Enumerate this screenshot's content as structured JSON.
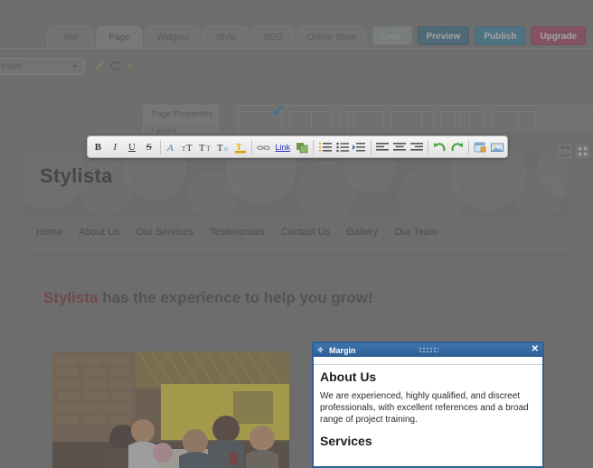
{
  "header": {
    "tabs": [
      {
        "label": "Site",
        "active": false
      },
      {
        "label": "Page",
        "active": true
      },
      {
        "label": "Widgets",
        "active": false
      },
      {
        "label": "Style",
        "active": false
      },
      {
        "label": "SEO",
        "active": false
      },
      {
        "label": "Online Store",
        "active": false
      }
    ],
    "actions": [
      {
        "label": "Save",
        "style": "act-save"
      },
      {
        "label": "Preview",
        "style": "act-preview"
      },
      {
        "label": "Publish",
        "style": "act-publish"
      },
      {
        "label": "Upgrade",
        "style": "act-upgrade"
      }
    ]
  },
  "toolbar_row": {
    "page_select_value": "index",
    "icons": [
      "pencil-icon",
      "refresh-icon",
      "diamond-icon"
    ],
    "menu": [
      {
        "label": "Page Properties",
        "selected": true
      },
      {
        "label": "Layout",
        "selected": false
      }
    ],
    "layout_thumbs_count": 6,
    "selected_layout_index": 0,
    "check_icon": "✔"
  },
  "format_toolbar": {
    "groups": [
      [
        "B",
        "I",
        "U",
        "S"
      ],
      [
        "A",
        "ᴛT",
        "Tᴛ",
        "Tₓ",
        "T"
      ],
      [
        "⚭",
        "Link",
        "⚓"
      ],
      [
        "≡",
        "≔",
        "⇥"
      ],
      [
        "≡",
        "≡",
        "≡"
      ],
      [
        "↶",
        "↷"
      ],
      [
        "▤",
        "▣"
      ]
    ]
  },
  "right_icons": [
    "code-icon",
    "grid-icon"
  ],
  "site": {
    "title": "Stylista",
    "nav": [
      "Home",
      "About Us",
      "Our Services",
      "Testimonials",
      "Contact Us",
      "Gallery",
      "Our Team"
    ],
    "headline_brand": "Stylista",
    "headline_rest": " has the experience to help you grow!"
  },
  "margin_dialog": {
    "title": "Margin",
    "move_icon": "✥",
    "close_icon": "✕",
    "heading": "About Us",
    "paragraph": "We are experienced, highly qualified, and discreet professionals, with excellent references and a broad range of project training.",
    "subheading": "Services"
  },
  "colors": {
    "accent_blue": "#1c7fa8",
    "upgrade_red": "#a8264a",
    "brand_maroon": "#7b2430",
    "dialog_blue": "#2d5f95"
  }
}
